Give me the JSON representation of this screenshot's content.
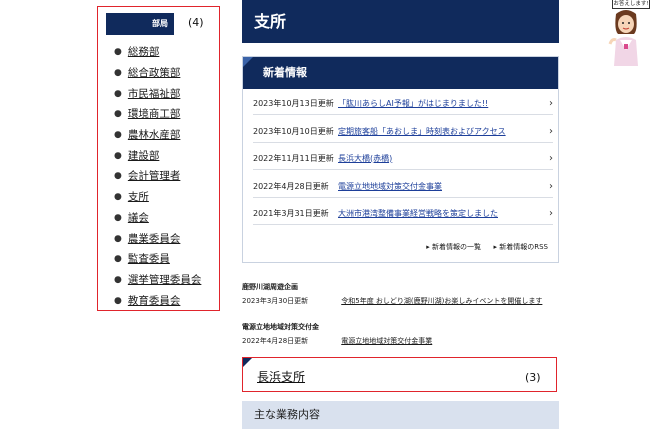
{
  "sidebar": {
    "heading": "部局",
    "marker": "(4)",
    "items": [
      {
        "label": "総務部"
      },
      {
        "label": "総合政策部"
      },
      {
        "label": "市民福祉部"
      },
      {
        "label": "環境商工部"
      },
      {
        "label": "農林水産部"
      },
      {
        "label": "建設部"
      },
      {
        "label": "会計管理者"
      },
      {
        "label": "支所"
      },
      {
        "label": "議会"
      },
      {
        "label": "農業委員会"
      },
      {
        "label": "監査委員"
      },
      {
        "label": "選挙管理委員会"
      },
      {
        "label": "教育委員会"
      }
    ]
  },
  "page": {
    "title": "支所"
  },
  "news": {
    "heading": "新着情報",
    "items": [
      {
        "date": "2023年10月13日更新",
        "text": "「肱川あらしAI予報」がはじまりました!!"
      },
      {
        "date": "2023年10月10日更新",
        "text": "定期旅客船「あおしま」時刻表およびアクセス"
      },
      {
        "date": "2022年11月11日更新",
        "text": "長浜大橋(赤橋)"
      },
      {
        "date": "2022年4月28日更新",
        "text": "電源立地地域対策交付金事業"
      },
      {
        "date": "2021年3月31日更新",
        "text": "大洲市港湾整備事業経営戦略を策定しました"
      }
    ],
    "list_link": "新着情報の一覧",
    "rss_link": "新着情報のRSS"
  },
  "sections": [
    {
      "heading": "鹿野川湖周遊企画",
      "date": "2023年3月30日更新",
      "text": "令和5年度 おしどり湖(鹿野川湖)お楽しみイベントを開催します"
    },
    {
      "heading": "電源立地地域対策交付金",
      "date": "2022年4月28日更新",
      "text": "電源立地地域対策交付金事業"
    }
  ],
  "office": {
    "name": "長浜支所",
    "marker": "(3)"
  },
  "duties": {
    "heading": "主な業務内容"
  },
  "mascot": {
    "bubble": "お答えします!"
  },
  "colors": {
    "navy": "#102a5c",
    "link": "#1d3f9a",
    "highlight_border": "#e0242c",
    "duties_bg": "#d9e1ee"
  },
  "icons": {
    "bullet": "bullet-icon",
    "chevron": "chevron-right-icon",
    "link_arrow": "triangle-right-icon"
  }
}
